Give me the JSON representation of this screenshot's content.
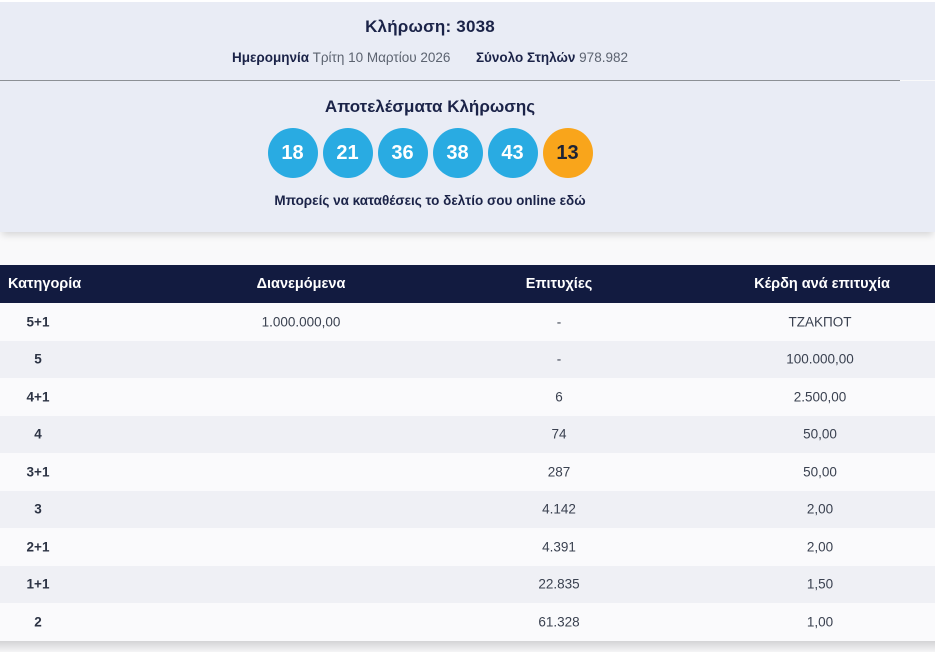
{
  "draw": {
    "title_label": "Κλήρωση:",
    "title_number": "3038",
    "date_label": "Ημερομηνία",
    "date_value": "Τρίτη 10 Μαρτίου 2026",
    "columns_label": "Σύνολο Στηλών",
    "columns_value": "978.982"
  },
  "results": {
    "heading": "Αποτελέσματα Κλήρωσης",
    "numbers": [
      "18",
      "21",
      "36",
      "38",
      "43"
    ],
    "bonus": "13",
    "online_text": "Μπορείς να καταθέσεις το δελτίο σου online εδώ"
  },
  "table": {
    "headers": [
      "Κατηγορία",
      "Διανεμόμενα",
      "Επιτυχίες",
      "Κέρδη ανά επιτυχία"
    ],
    "rows": [
      {
        "category": "5+1",
        "distributed": "1.000.000,00",
        "winners": "-",
        "prize": "ΤΖΑΚΠΟΤ"
      },
      {
        "category": "5",
        "distributed": "",
        "winners": "-",
        "prize": "100.000,00"
      },
      {
        "category": "4+1",
        "distributed": "",
        "winners": "6",
        "prize": "2.500,00"
      },
      {
        "category": "4",
        "distributed": "",
        "winners": "74",
        "prize": "50,00"
      },
      {
        "category": "3+1",
        "distributed": "",
        "winners": "287",
        "prize": "50,00"
      },
      {
        "category": "3",
        "distributed": "",
        "winners": "4.142",
        "prize": "2,00"
      },
      {
        "category": "2+1",
        "distributed": "",
        "winners": "4.391",
        "prize": "2,00"
      },
      {
        "category": "1+1",
        "distributed": "",
        "winners": "22.835",
        "prize": "1,50"
      },
      {
        "category": "2",
        "distributed": "",
        "winners": "61.328",
        "prize": "1,00"
      }
    ]
  },
  "colors": {
    "ball_blue": "#29ABE2",
    "ball_orange": "#F9A51B",
    "header_navy": "#121B40",
    "section_bg": "#E9ECF5",
    "row_alt": "#EFF0F5"
  }
}
